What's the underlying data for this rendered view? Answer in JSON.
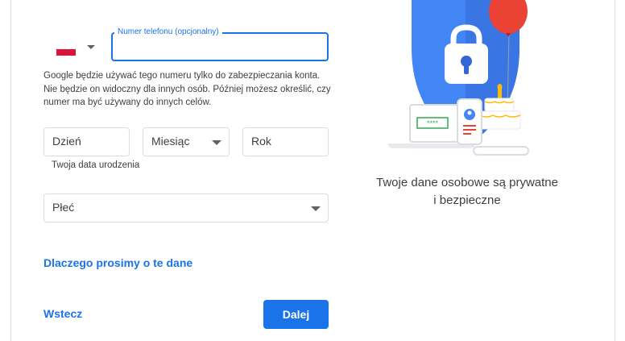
{
  "phone": {
    "label": "Numer telefonu (opcjonalny)",
    "value": "",
    "helper": "Google będzie używać tego numeru tylko do zabezpieczania konta. Nie będzie on widoczny dla innych osób. Później możesz określić, czy numer ma być używany do innych celów."
  },
  "birthdate": {
    "day_placeholder": "Dzień",
    "month_placeholder": "Miesiąc",
    "year_placeholder": "Rok",
    "helper": "Twoja data urodzenia"
  },
  "gender": {
    "placeholder": "Płeć"
  },
  "links": {
    "why": "Dlaczego prosimy o te dane"
  },
  "actions": {
    "back": "Wstecz",
    "next": "Dalej"
  },
  "illustration": {
    "caption_line1": "Twoje dane osobowe są prywatne",
    "caption_line2": "i bezpieczne",
    "password_mask": "****"
  },
  "colors": {
    "accent": "#1a73e8",
    "shield": "#4285f4",
    "balloon": "#ea4335"
  }
}
